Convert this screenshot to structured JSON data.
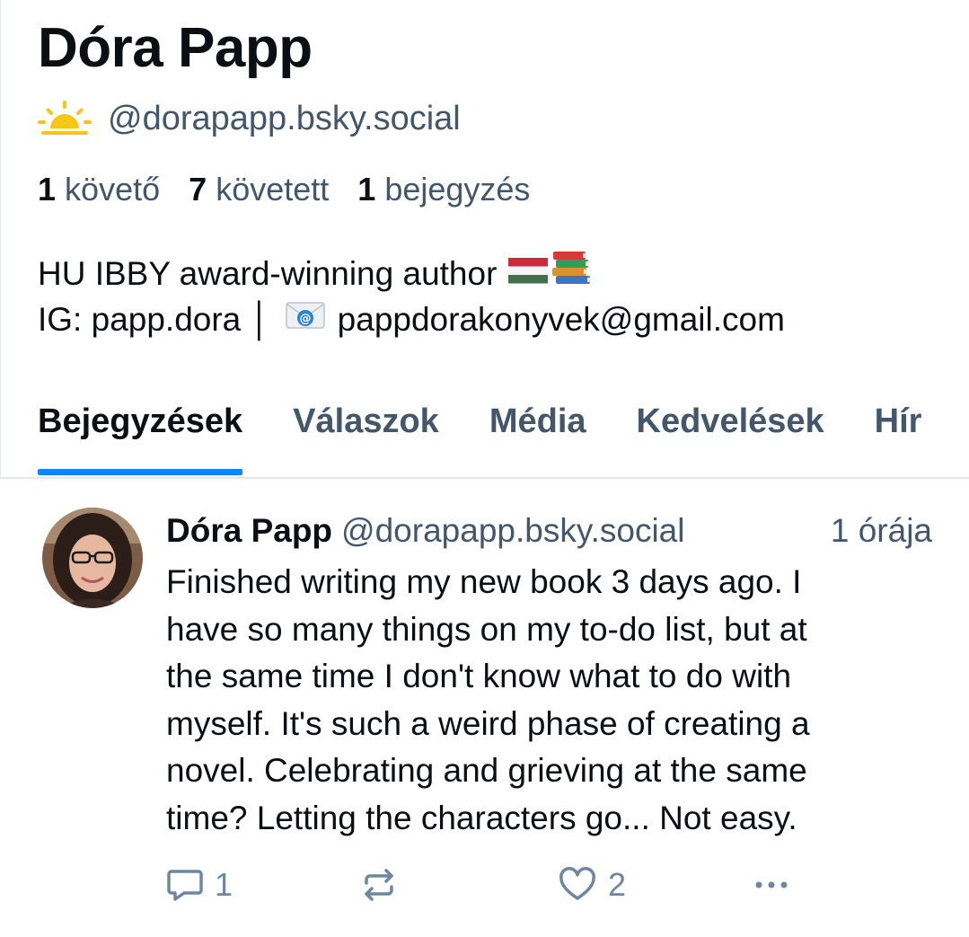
{
  "profile": {
    "display_name": "Dóra Papp",
    "handle": "@dorapapp.bsky.social",
    "handle_icon": "sun-rising-icon",
    "stats": {
      "followers_count": "1",
      "followers_label": "követő",
      "following_count": "7",
      "following_label": "követett",
      "posts_count": "1",
      "posts_label": "bejegyzés"
    },
    "bio": {
      "line1": "HU IBBY award-winning author",
      "line1_emojis": [
        "hungarian-flag-icon",
        "books-icon"
      ],
      "line2_prefix": "IG: papp.dora │",
      "line2_icon": "email-icon",
      "line2_email": "pappdorakonyvek@gmail.com"
    }
  },
  "tabs": [
    {
      "label": "Bejegyzések",
      "active": true
    },
    {
      "label": "Válaszok",
      "active": false
    },
    {
      "label": "Média",
      "active": false
    },
    {
      "label": "Kedvelések",
      "active": false
    },
    {
      "label": "Hír",
      "active": false
    }
  ],
  "post": {
    "author": "Dóra Papp",
    "handle": "@dorapapp.bsky.social",
    "time": "1 órája",
    "text_lines": [
      "Finished writing my new book 3 days ago. I",
      "have so many things on my to-do list, but at",
      "the same time I don't know what to do with",
      "myself. It's such a weird phase of creating a",
      "novel. Celebrating and grieving at the same",
      "time? Letting the characters go... Not easy."
    ],
    "reply_count": "1",
    "repost_count": "",
    "like_count": "2"
  },
  "colors": {
    "accent": "#1083fe",
    "text": "#0b0f14",
    "muted": "#42576c",
    "icon": "#6f869f",
    "sun": "#f5c518"
  }
}
